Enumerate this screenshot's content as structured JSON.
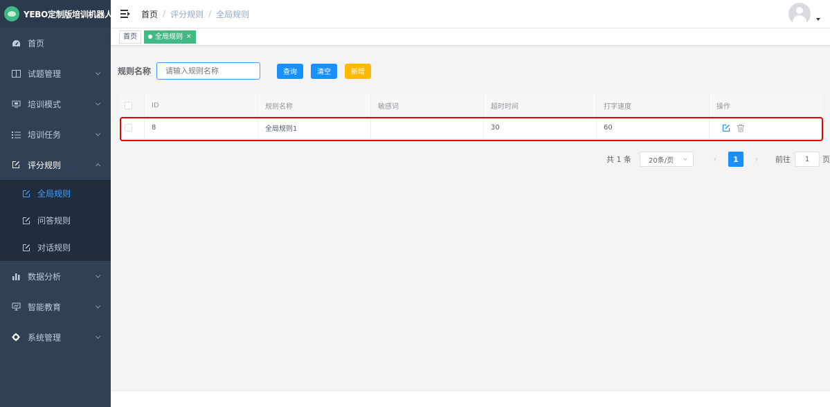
{
  "app": {
    "title": "YEBO定制版培训机器人"
  },
  "sidebar": {
    "items": [
      {
        "label": "首页",
        "icon": "dashboard-icon"
      },
      {
        "label": "试题管理",
        "icon": "book-icon"
      },
      {
        "label": "培训模式",
        "icon": "monitor-icon"
      },
      {
        "label": "培训任务",
        "icon": "list-icon"
      },
      {
        "label": "评分规则",
        "icon": "edit-icon",
        "open": true
      },
      {
        "label": "数据分析",
        "icon": "bar-chart-icon"
      },
      {
        "label": "智能教育",
        "icon": "screen-icon"
      },
      {
        "label": "系统管理",
        "icon": "gear-icon"
      }
    ],
    "sub_items": [
      {
        "label": "全局规则",
        "active": true
      },
      {
        "label": "问答规则"
      },
      {
        "label": "对话规则"
      }
    ]
  },
  "header": {
    "breadcrumb": [
      "首页",
      "评分规则",
      "全局规则"
    ],
    "separator": "/"
  },
  "tags": [
    {
      "label": "首页",
      "active": false
    },
    {
      "label": "全局规则",
      "active": true,
      "close": "×"
    }
  ],
  "search": {
    "label": "规则名称",
    "placeholder": "请输入规则名称",
    "query_button": "查询",
    "clear_button": "清空",
    "add_button": "新增"
  },
  "table": {
    "columns": [
      "ID",
      "规则名称",
      "敏感词",
      "超时时间",
      "打字速度",
      "操作"
    ],
    "rows": [
      {
        "id": "8",
        "name": "全局规则1",
        "sensitive": "",
        "timeout": "30",
        "speed": "60"
      }
    ]
  },
  "pagination": {
    "total": "共 1 条",
    "page_size": "20条/页",
    "current": "1",
    "goto_prefix": "前往",
    "goto_value": "1",
    "goto_suffix": "页"
  },
  "colors": {
    "sidebar_bg": "#304156",
    "primary": "#1890ff",
    "warning": "#ffba00",
    "tag_active": "#42b983",
    "highlight": "#e60000"
  }
}
